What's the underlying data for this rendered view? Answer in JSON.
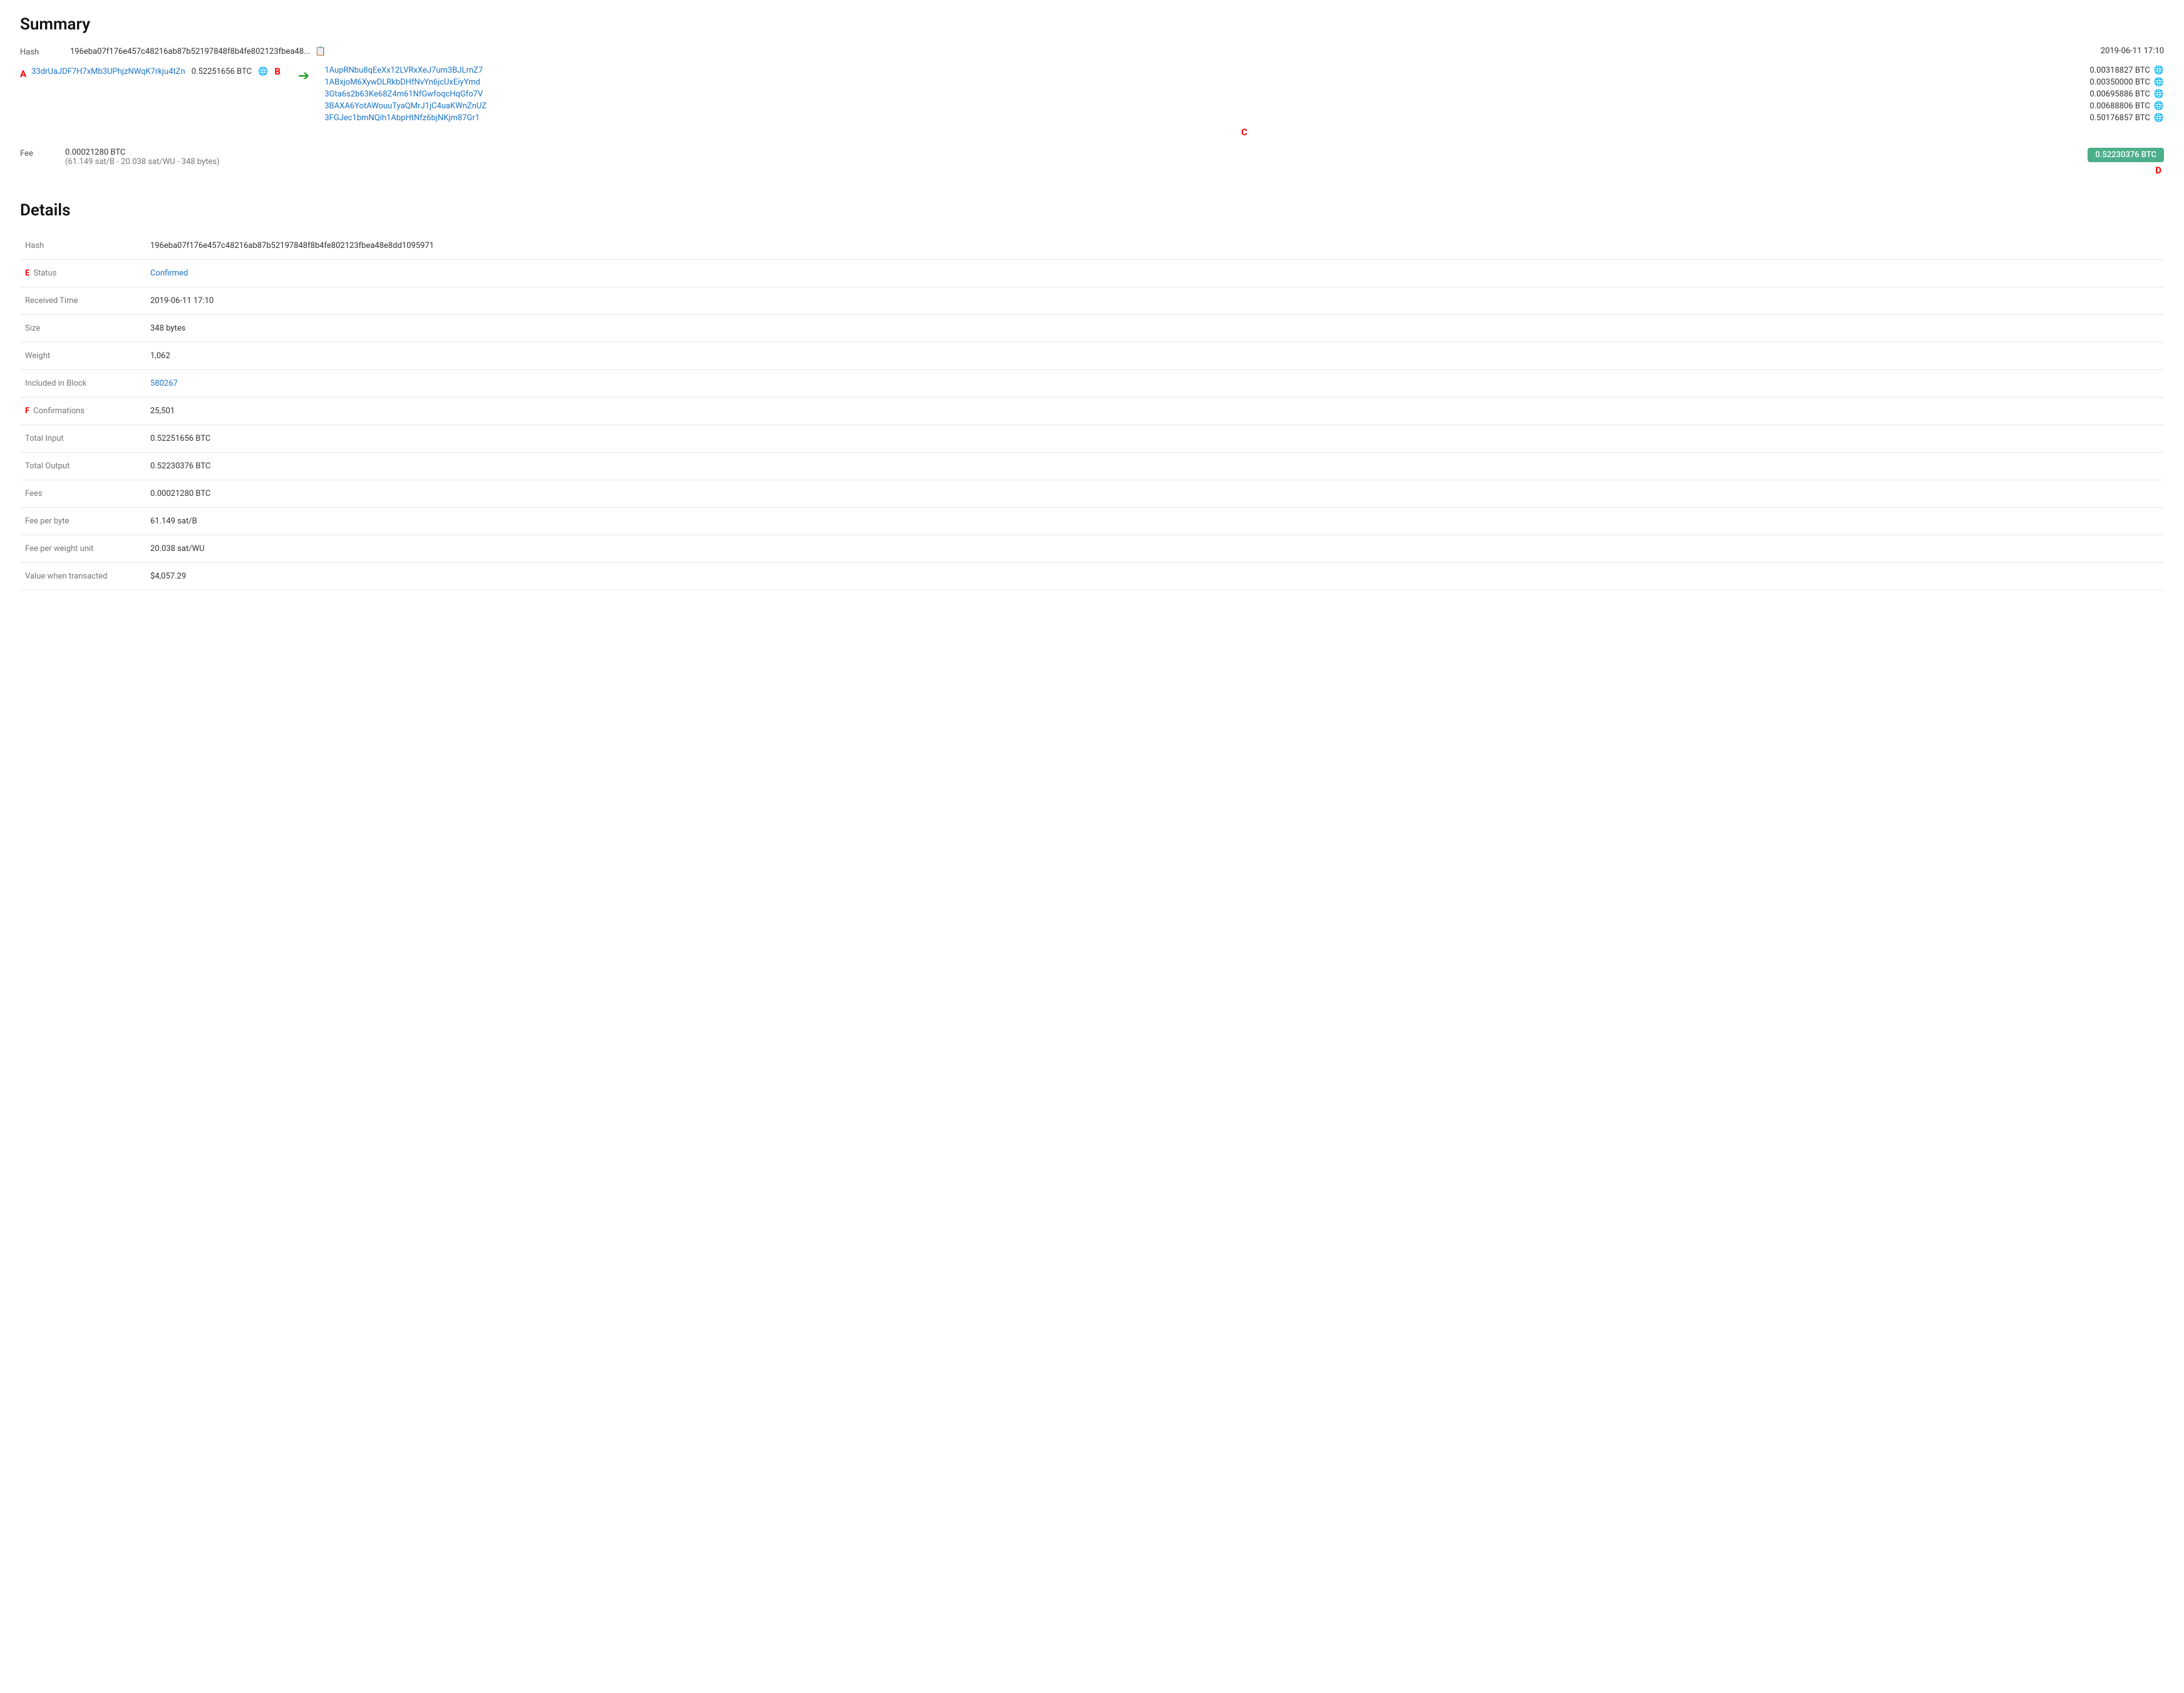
{
  "summary": {
    "title": "Summary",
    "hash_label": "Hash",
    "hash_short": "196eba07f176e457c48216ab87b52197848f8b4fe802123fbea48...",
    "timestamp": "2019-06-11 17:10",
    "input_address": "33drUaJDF7H7xMb3UPhjzNWqK7rkju4tZn",
    "input_amount": "0.52251656 BTC",
    "fee_label": "Fee",
    "fee_main": "0.00021280 BTC",
    "fee_detail": "(61.149 sat/B - 20.038 sat/WU - 348 bytes)",
    "total_output": "0.52230376 BTC",
    "outputs": [
      {
        "address": "1AupRNbu8qEeXx12LVRxXeJ7um3BJLrnZ7",
        "amount": "0.00318827 BTC"
      },
      {
        "address": "1ABxjoM6XywDLRkbDHfNvYn6jcUxEiyYmd",
        "amount": "0.00350000 BTC"
      },
      {
        "address": "3Gta6s2b63Ke68Z4m61NfGwfoqcHqGfo7V",
        "amount": "0.00695886 BTC"
      },
      {
        "address": "3BAXA6YotAWouuTyaQMrJ1jC4uaKWnZnUZ",
        "amount": "0.00688806 BTC"
      },
      {
        "address": "3FGJec1bmNQih1AbpHtNfz6bjNKjm87Gr1",
        "amount": "0.50176857 BTC"
      }
    ],
    "label_a": "A",
    "label_b": "B",
    "label_c": "C",
    "label_d": "D"
  },
  "details": {
    "title": "Details",
    "rows": [
      {
        "label": "Hash",
        "value": "196eba07f176e457c48216ab87b52197848f8b4fe802123fbea48e8dd1095971",
        "type": "text"
      },
      {
        "label": "Status",
        "value": "Confirmed",
        "type": "status"
      },
      {
        "label": "Received Time",
        "value": "2019-06-11 17:10",
        "type": "text"
      },
      {
        "label": "Size",
        "value": "348 bytes",
        "type": "text"
      },
      {
        "label": "Weight",
        "value": "1,062",
        "type": "text"
      },
      {
        "label": "Included in Block",
        "value": "580267",
        "type": "link"
      },
      {
        "label": "Confirmations",
        "value": "25,501",
        "type": "text"
      },
      {
        "label": "Total Input",
        "value": "0.52251656 BTC",
        "type": "text"
      },
      {
        "label": "Total Output",
        "value": "0.52230376 BTC",
        "type": "text"
      },
      {
        "label": "Fees",
        "value": "0.00021280 BTC",
        "type": "text"
      },
      {
        "label": "Fee per byte",
        "value": "61.149 sat/B",
        "type": "text"
      },
      {
        "label": "Fee per weight unit",
        "value": "20.038 sat/WU",
        "type": "text"
      },
      {
        "label": "Value when transacted",
        "value": "$4,057.29",
        "type": "text"
      }
    ],
    "label_e": "E",
    "label_f": "F"
  }
}
